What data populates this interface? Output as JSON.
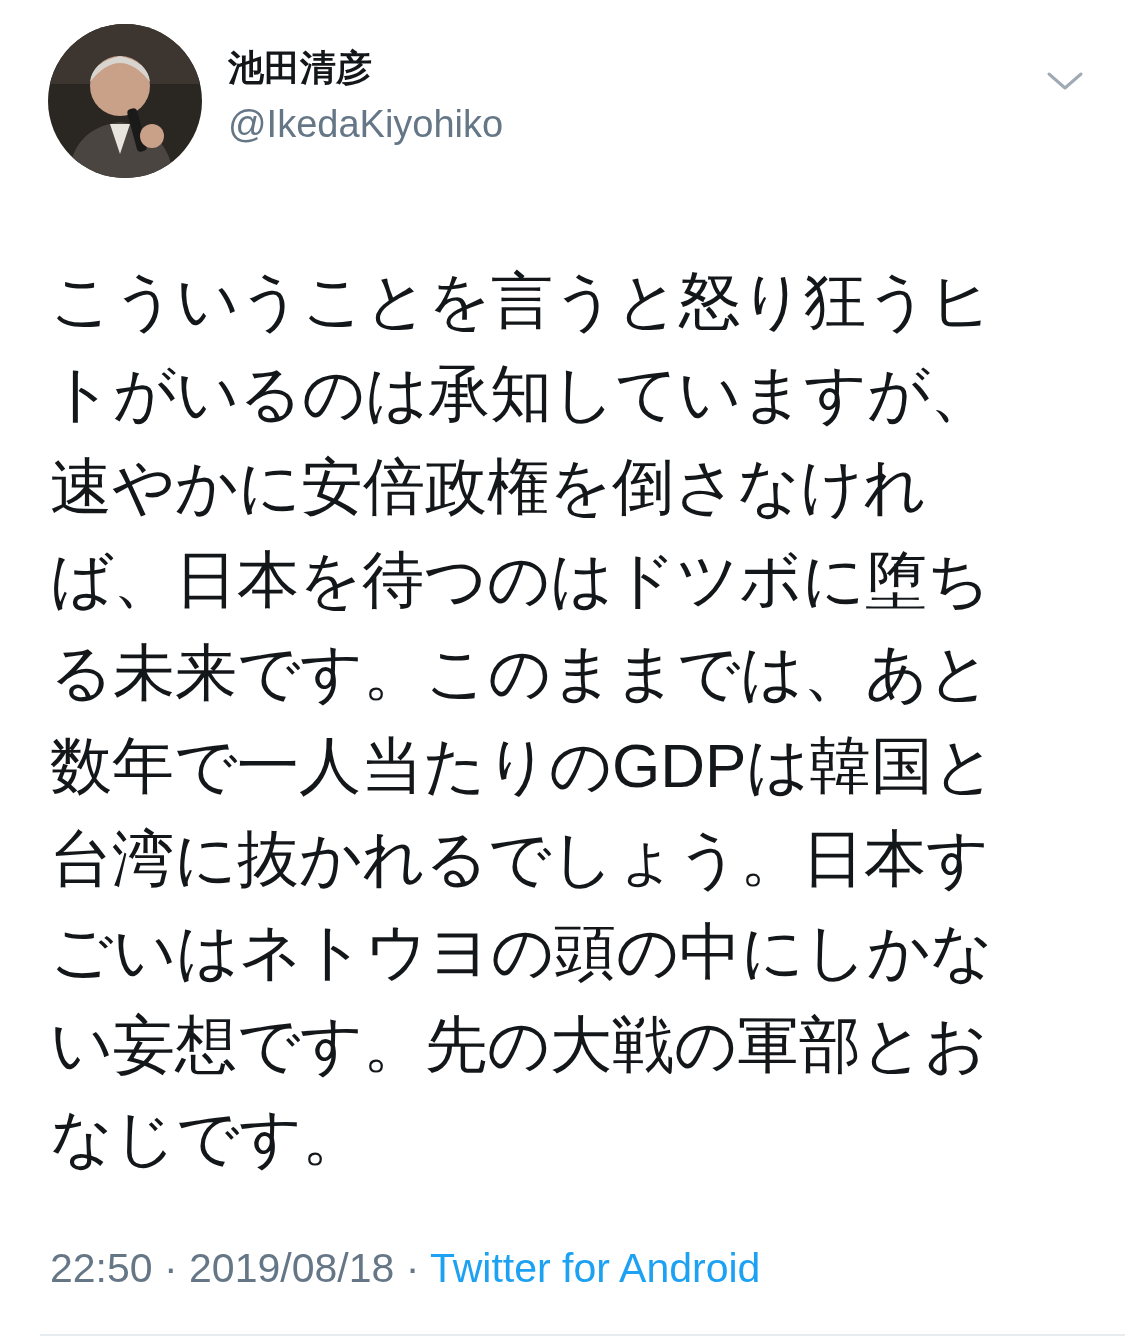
{
  "author": {
    "name": "池田清彦",
    "handle": "@IkedaKiyohiko"
  },
  "tweet": {
    "lines": [
      "こういうことを言うと怒り狂うヒ",
      "トがいるのは承知していますが、",
      "速やかに安倍政権を倒さなけれ",
      "ば、日本を待つのはドツボに堕ち",
      "る未来です。このままでは、あと",
      "数年で一人当たりのGDPは韓国と",
      "台湾に抜かれるでしょう。日本す",
      "ごいはネトウヨの頭の中にしかな",
      "い妄想です。先の大戦の軍部とお",
      "なじです。"
    ]
  },
  "meta": {
    "timestamp": "22:50 · 2019/08/18 ·",
    "source": "Twitter for Android"
  }
}
